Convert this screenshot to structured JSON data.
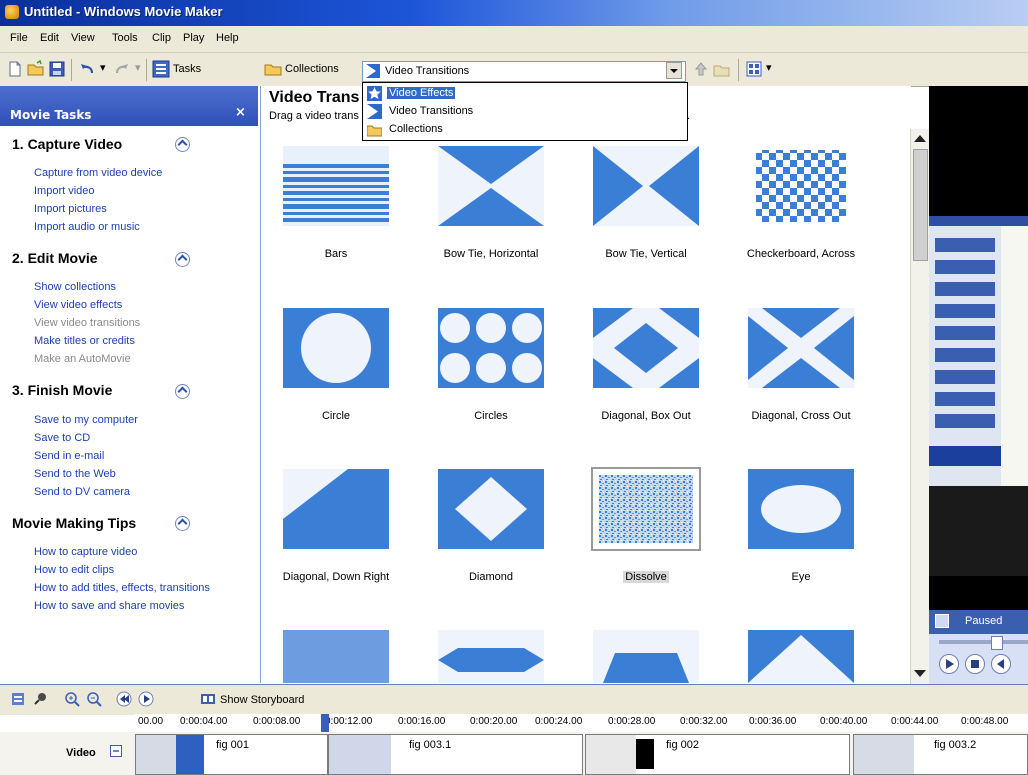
{
  "window": {
    "title": "Untitled - Windows Movie Maker"
  },
  "menu": [
    "File",
    "Edit",
    "View",
    "Tools",
    "Clip",
    "Play",
    "Help"
  ],
  "toolbar": {
    "tasks_label": "Tasks",
    "collections_label": "Collections",
    "location_value": "Video Transitions"
  },
  "dropdown": [
    {
      "label": "Video Effects",
      "icon": "star-icon",
      "selected": true
    },
    {
      "label": "Video Transitions",
      "icon": "transition-icon",
      "selected": false
    },
    {
      "label": "Collections",
      "icon": "folder-icon",
      "selected": false
    }
  ],
  "task_pane": {
    "header": "Movie Tasks",
    "close_glyph": "×",
    "sections": [
      {
        "title": "1. Capture Video",
        "links": [
          {
            "text": "Capture from video device",
            "disabled": false
          },
          {
            "text": "Import video",
            "disabled": false
          },
          {
            "text": "Import pictures",
            "disabled": false
          },
          {
            "text": "Import audio or music",
            "disabled": false
          }
        ]
      },
      {
        "title": "2. Edit Movie",
        "links": [
          {
            "text": "Show collections",
            "disabled": false
          },
          {
            "text": "View video effects",
            "disabled": false
          },
          {
            "text": "View video transitions",
            "disabled": true
          },
          {
            "text": "Make titles or credits",
            "disabled": false
          },
          {
            "text": "Make an AutoMovie",
            "disabled": true
          }
        ]
      },
      {
        "title": "3. Finish Movie",
        "links": [
          {
            "text": "Save to my computer",
            "disabled": false
          },
          {
            "text": "Save to CD",
            "disabled": false
          },
          {
            "text": "Send in e-mail",
            "disabled": false
          },
          {
            "text": "Send to the Web",
            "disabled": false
          },
          {
            "text": "Send to DV camera",
            "disabled": false
          }
        ]
      },
      {
        "title": "Movie Making Tips",
        "links": [
          {
            "text": "How to capture video",
            "disabled": false
          },
          {
            "text": "How to edit clips",
            "disabled": false
          },
          {
            "text": "How to add titles, effects, transitions",
            "disabled": false
          },
          {
            "text": "How to save and share movies",
            "disabled": false
          }
        ]
      }
    ]
  },
  "content": {
    "title": "Video Trans",
    "description": "Drag a video trans",
    "description_tail": "."
  },
  "transitions": [
    {
      "label": "Bars",
      "icon": "bars-icon",
      "selected": false
    },
    {
      "label": "Bow Tie, Horizontal",
      "icon": "bow-tie-horizontal-icon",
      "selected": false
    },
    {
      "label": "Bow Tie, Vertical",
      "icon": "bow-tie-vertical-icon",
      "selected": false
    },
    {
      "label": "Checkerboard, Across",
      "icon": "checkerboard-icon",
      "selected": false
    },
    {
      "label": "Circle",
      "icon": "circle-icon",
      "selected": false
    },
    {
      "label": "Circles",
      "icon": "circles-icon",
      "selected": false
    },
    {
      "label": "Diagonal, Box Out",
      "icon": "diagonal-box-out-icon",
      "selected": false
    },
    {
      "label": "Diagonal, Cross Out",
      "icon": "diagonal-cross-out-icon",
      "selected": false
    },
    {
      "label": "Diagonal, Down Right",
      "icon": "diagonal-down-right-icon",
      "selected": false
    },
    {
      "label": "Diamond",
      "icon": "diamond-icon",
      "selected": false
    },
    {
      "label": "Dissolve",
      "icon": "dissolve-icon",
      "selected": true
    },
    {
      "label": "Eye",
      "icon": "eye-icon",
      "selected": false
    }
  ],
  "preview": {
    "status": "Paused"
  },
  "timeline": {
    "show_storyboard_label": "Show Storyboard",
    "ticks": [
      "00.00",
      "0:00:04.00",
      "0:00:08.00",
      "0:00:12.00",
      "0:00:16.00",
      "0:00:20.00",
      "0:00:24.00",
      "0:00:28.00",
      "0:00:32.00",
      "0:00:36.00",
      "0:00:40.00",
      "0:00:44.00",
      "0:00:48.00"
    ],
    "track_label": "Video",
    "clips": [
      "fig 001",
      "fig 003.1",
      "fig 002",
      "fig 003.2"
    ]
  },
  "colors": {
    "accent": "#316ac5",
    "link": "#1c3fb0",
    "thumb_blue": "#3a7fd5"
  }
}
